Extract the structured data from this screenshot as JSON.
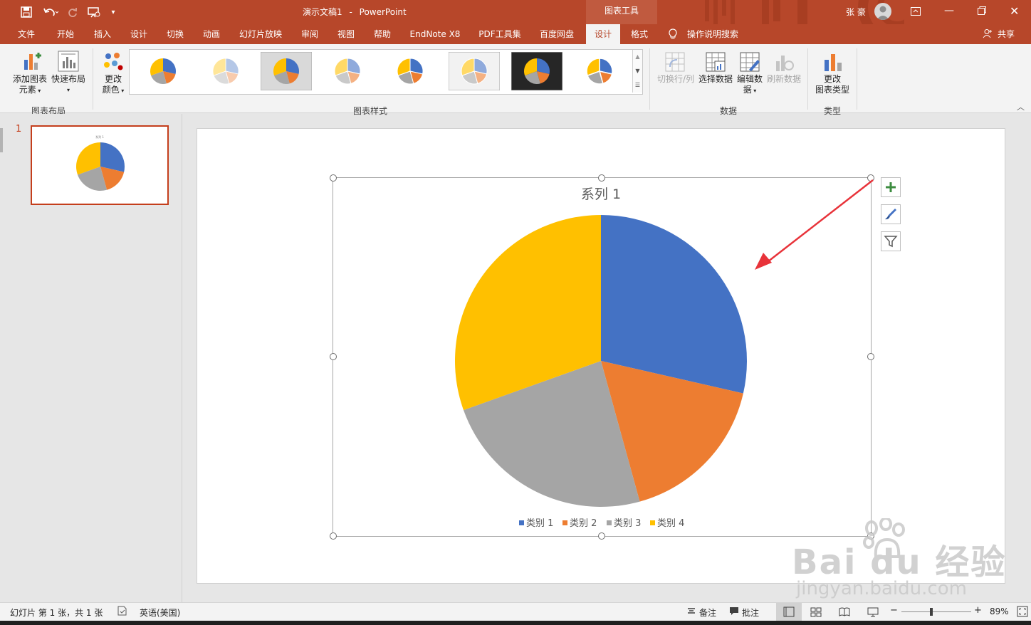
{
  "window": {
    "doc_title": "演示文稿1",
    "separator": "-",
    "app_name": "PowerPoint",
    "context_tab_group": "图表工具",
    "user_name": "张 豪"
  },
  "menu_tabs": [
    "文件",
    "开始",
    "插入",
    "设计",
    "切换",
    "动画",
    "幻灯片放映",
    "审阅",
    "视图",
    "帮助",
    "EndNote X8",
    "PDF工具集",
    "百度网盘",
    "设计",
    "格式"
  ],
  "tell_me": "操作说明搜索",
  "share_label": "共享",
  "ribbon": {
    "add_element": [
      "添加图表",
      "元素"
    ],
    "quick_layout": "快速布局",
    "change_colors": [
      "更改",
      "颜色"
    ],
    "group_layout": "图表布局",
    "group_styles": "图表样式",
    "switch_row_col": "切换行/列",
    "select_data": "选择数据",
    "edit_data": [
      "编辑数",
      "据"
    ],
    "refresh_data": "刷新数据",
    "group_data": "数据",
    "change_type": [
      "更改",
      "图表类型"
    ],
    "group_type": "类型"
  },
  "slide_number": "1",
  "status": {
    "slide_info": "幻灯片 第 1 张，共 1 张",
    "language": "英语(美国)",
    "notes": "备注",
    "comments": "批注",
    "zoom_minus": "−",
    "zoom_plus": "+",
    "zoom": "89%"
  },
  "watermark": {
    "brand": "Bai du 经验",
    "url": "jingyan.baidu.com"
  },
  "colors": {
    "brand": "#b7472a",
    "blue": "#4472c4",
    "orange": "#ed7d31",
    "gray": "#a5a5a5",
    "gold": "#ffc000",
    "arrow": "#e8333a"
  },
  "chart_data": {
    "type": "pie",
    "title": "系列 1",
    "categories": [
      "类别 1",
      "类别 2",
      "类别 3",
      "类别 4"
    ],
    "values": [
      30,
      18,
      25,
      32
    ],
    "colors": [
      "#4472c4",
      "#ed7d31",
      "#a5a5a5",
      "#ffc000"
    ],
    "start_angle_deg": 0,
    "legend": "bottom"
  }
}
